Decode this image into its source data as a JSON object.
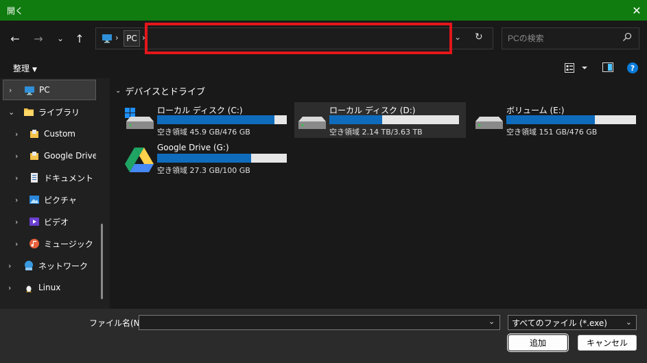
{
  "window": {
    "title": "開く",
    "close_icon": "close-icon"
  },
  "address": {
    "crumb": "PC",
    "value": ""
  },
  "search": {
    "placeholder": "PCの検索"
  },
  "toolbar": {
    "organize_label": "整理"
  },
  "sidebar": {
    "items": [
      {
        "label": "PC",
        "icon": "pc-icon",
        "selected": true
      },
      {
        "label": "ライブラリ",
        "icon": "folder-icon",
        "expanded": true
      },
      {
        "label": "Custom",
        "icon": "library-icon"
      },
      {
        "label": "Google Drive (",
        "icon": "library-icon"
      },
      {
        "label": "ドキュメント",
        "icon": "documents-icon"
      },
      {
        "label": "ピクチャ",
        "icon": "pictures-icon"
      },
      {
        "label": "ビデオ",
        "icon": "videos-icon"
      },
      {
        "label": "ミュージック",
        "icon": "music-icon"
      },
      {
        "label": "ネットワーク",
        "icon": "network-icon"
      },
      {
        "label": "Linux",
        "icon": "linux-icon"
      }
    ]
  },
  "content": {
    "group_title": "デバイスとドライブ",
    "drives": [
      {
        "name": "ローカル ディスク (C:)",
        "free": "空き領域 45.9 GB/476 GB",
        "used_fraction": 0.904,
        "icon": "windows-drive-icon"
      },
      {
        "name": "ローカル ディスク (D:)",
        "free": "空き領域 2.14 TB/3.63 TB",
        "used_fraction": 0.41,
        "icon": "hard-drive-icon"
      },
      {
        "name": "ボリューム (E:)",
        "free": "空き領域 151 GB/476 GB",
        "used_fraction": 0.683,
        "icon": "hard-drive-icon"
      },
      {
        "name": "Google Drive (G:)",
        "free": "空き領域 27.3 GB/100 GB",
        "used_fraction": 0.727,
        "icon": "google-drive-icon"
      }
    ]
  },
  "footer": {
    "filename_label": "ファイル名(N):",
    "filename_value": "",
    "filetype": "すべてのファイル (*.exe)",
    "open_label": "追加",
    "cancel_label": "キャンセル"
  },
  "colors": {
    "titlebar": "#107c10",
    "accent": "#0f6cbd",
    "highlight": "#e3161b"
  }
}
